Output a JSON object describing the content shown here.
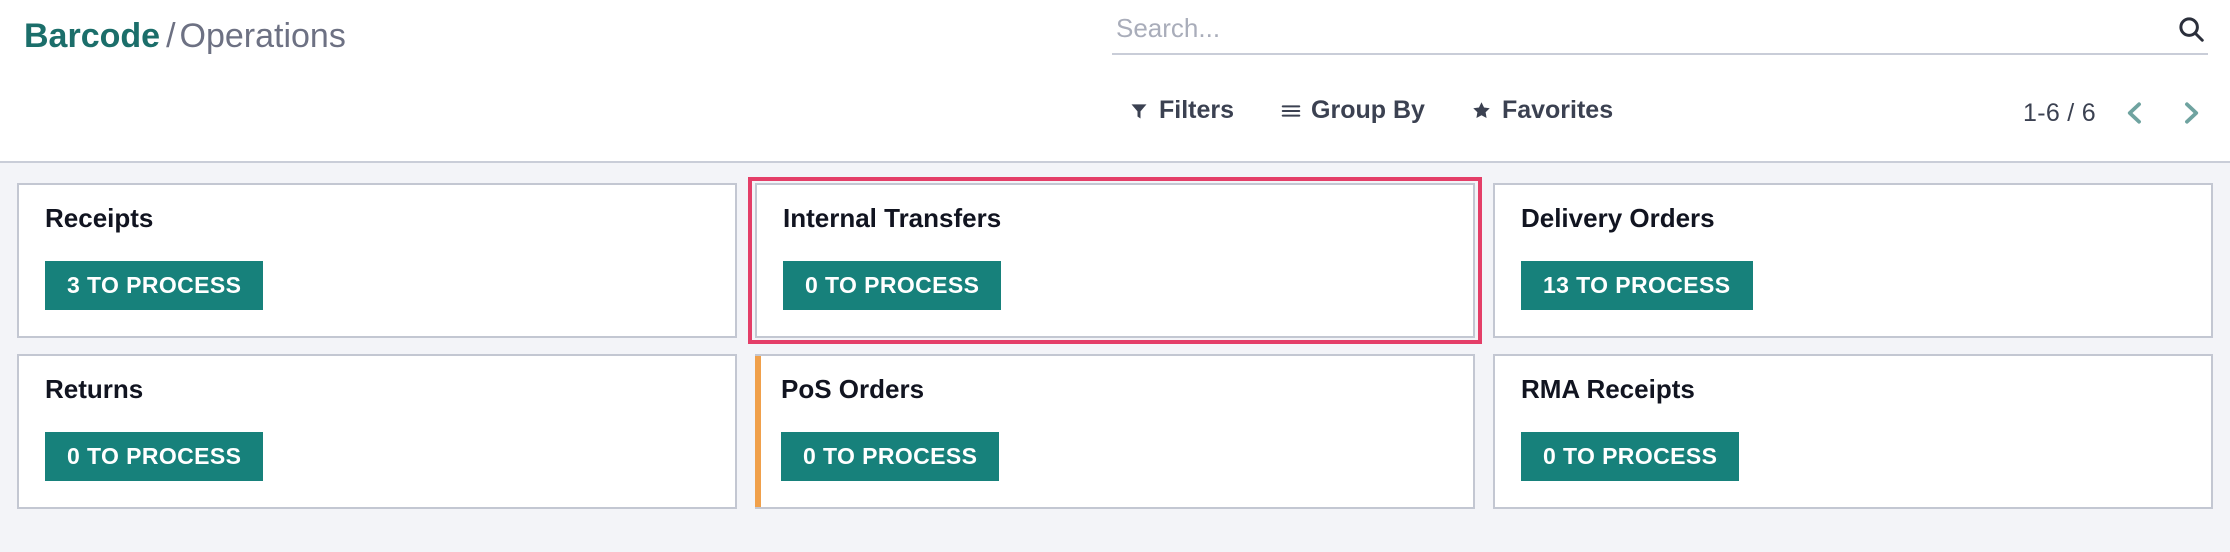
{
  "breadcrumb": {
    "root": "Barcode",
    "separator": "/",
    "current": "Operations"
  },
  "search": {
    "placeholder": "Search...",
    "value": "",
    "icon": "search-icon"
  },
  "search_options": [
    {
      "label": "Filters",
      "icon": "filter-funnel-icon"
    },
    {
      "label": "Group By",
      "icon": "group-by-lines-icon"
    },
    {
      "label": "Favorites",
      "icon": "star-icon"
    }
  ],
  "pager": {
    "value": "1-6 / 6",
    "prev_icon": "chevron-left-icon",
    "next_icon": "chevron-right-icon"
  },
  "colors": {
    "brand_teal": "#1b6e6a",
    "button_teal": "#17817b",
    "highlight_pink": "#e43e68",
    "accent_orange": "#f0a04b",
    "kanban_bg": "#f3f4f8",
    "card_border": "#c3c7d2",
    "text_dark": "#3b4151"
  },
  "kanban": {
    "cards": [
      {
        "title": "Receipts",
        "button_label": "3 TO PROCESS",
        "accent_color": null,
        "highlighted": false
      },
      {
        "title": "Internal Transfers",
        "button_label": "0 TO PROCESS",
        "accent_color": null,
        "highlighted": true
      },
      {
        "title": "Delivery Orders",
        "button_label": "13 TO PROCESS",
        "accent_color": null,
        "highlighted": false
      },
      {
        "title": "Returns",
        "button_label": "0 TO PROCESS",
        "accent_color": null,
        "highlighted": false
      },
      {
        "title": "PoS Orders",
        "button_label": "0 TO PROCESS",
        "accent_color": "#f0a04b",
        "highlighted": false
      },
      {
        "title": "RMA Receipts",
        "button_label": "0 TO PROCESS",
        "accent_color": null,
        "highlighted": false
      }
    ]
  }
}
